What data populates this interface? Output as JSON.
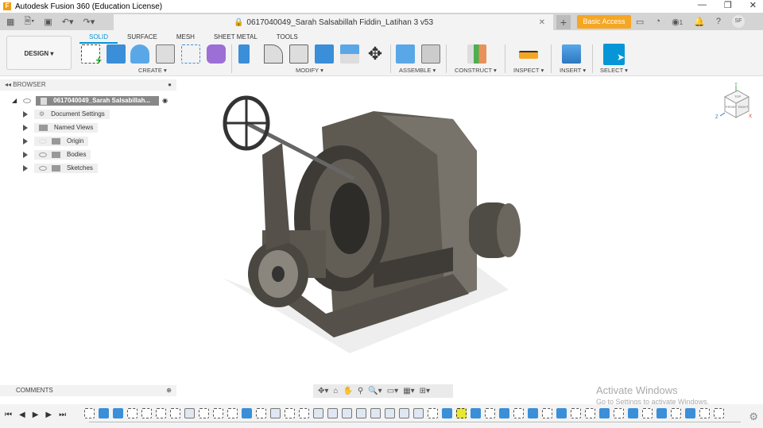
{
  "window": {
    "title": "Autodesk Fusion 360 (Education License)",
    "logo": "F",
    "controls": [
      "minimize-icon",
      "restore-icon",
      "close-icon"
    ]
  },
  "tabbar": {
    "document_title": "0617040049_Sarah Salsabillah Fiddin_Latihan 3 v53",
    "basic_access": "Basic Access",
    "job_count": "1",
    "user_initials": "SF"
  },
  "toolbar": {
    "workspace": "DESIGN ▾",
    "tabs": [
      "SOLID",
      "SURFACE",
      "MESH",
      "SHEET METAL",
      "TOOLS"
    ],
    "active_tab": "SOLID",
    "groups": [
      "CREATE ▾",
      "MODIFY ▾",
      "ASSEMBLE ▾",
      "CONSTRUCT ▾",
      "INSPECT ▾",
      "INSERT ▾",
      "SELECT ▾"
    ]
  },
  "browser": {
    "title": "BROWSER",
    "root": "0617040049_Sarah Salsabillah...",
    "items": [
      "Document Settings",
      "Named Views",
      "Origin",
      "Bodies",
      "Sketches"
    ]
  },
  "comments": {
    "title": "COMMENTS"
  },
  "watermark": {
    "line1": "Activate Windows",
    "line2": "Go to Settings to activate Windows."
  },
  "viewcube": {
    "top": "TOP",
    "front": "FRONT",
    "right": "RIGHT",
    "axis_x": "X",
    "axis_y": "Y",
    "axis_z": "Z"
  },
  "timeline": {
    "features": [
      "s",
      "e",
      "e",
      "s",
      "s",
      "s",
      "s",
      "f",
      "s",
      "s",
      "s",
      "e",
      "s",
      "f",
      "s",
      "s",
      "f",
      "f",
      "f",
      "f",
      "f",
      "f",
      "f",
      "f",
      "s",
      "e",
      "h",
      "e",
      "s",
      "e",
      "s",
      "e",
      "s",
      "e",
      "s",
      "s",
      "e",
      "s",
      "e",
      "s",
      "e",
      "s",
      "e",
      "s",
      "s"
    ]
  }
}
